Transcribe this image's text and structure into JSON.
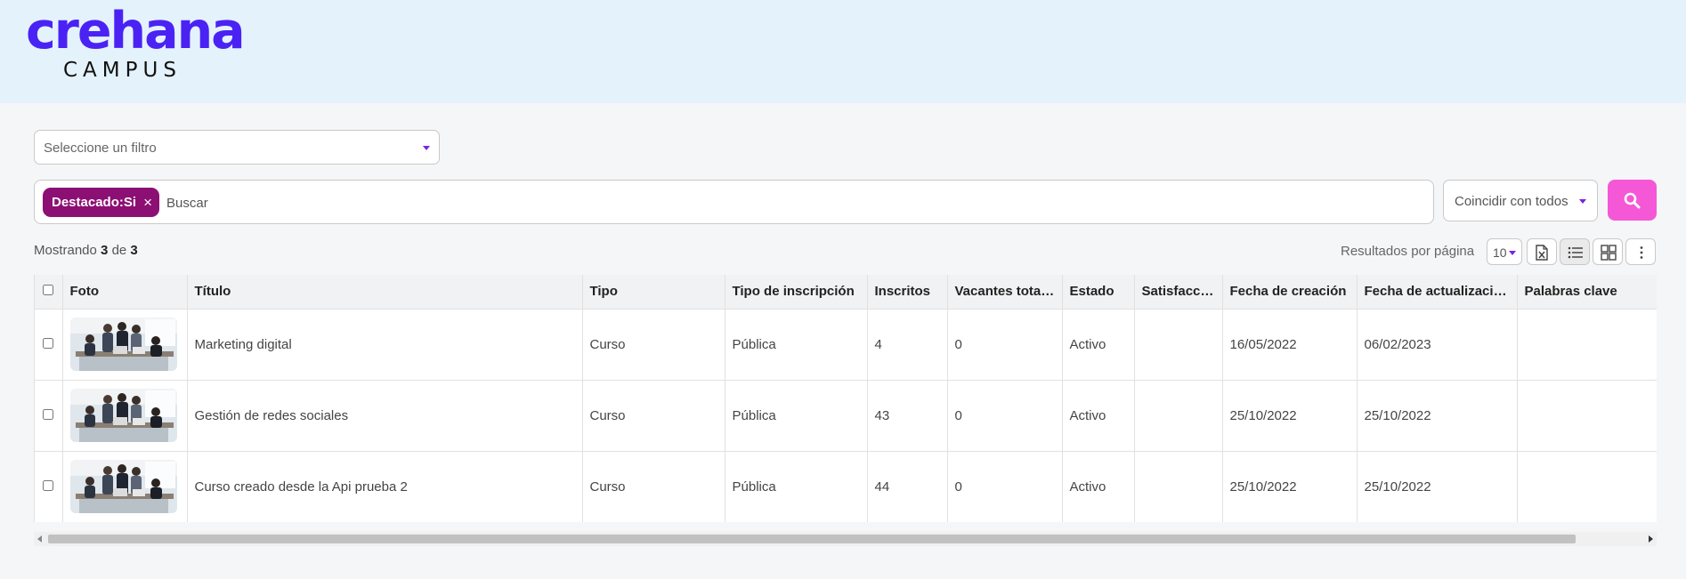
{
  "brand": {
    "name": "crehana",
    "sub": "CAMPUS",
    "color": "#4b22f4"
  },
  "filter": {
    "placeholder": "Seleccione un filtro"
  },
  "search": {
    "chip_label": "Destacado:Si",
    "chip_remove": "×",
    "placeholder": "Buscar",
    "match_mode": "Coincidir con todos",
    "button_icon": "search-icon",
    "button_color": "#f458d6",
    "chip_color": "#8c0f73"
  },
  "results": {
    "prefix": "Mostrando",
    "shown": "3",
    "of": "de",
    "total": "3",
    "per_page_label": "Resultados por página",
    "per_page": "10"
  },
  "toolbar": {
    "icons": [
      "excel-export-icon",
      "list-view-icon",
      "grid-view-icon",
      "more-options-icon"
    ]
  },
  "table": {
    "columns": [
      "Foto",
      "Título",
      "Tipo",
      "Tipo de inscripción",
      "Inscritos",
      "Vacantes total…",
      "Estado",
      "Satisfacci…",
      "Fecha de creación",
      "Fecha de actualización",
      "Palabras clave"
    ],
    "rows": [
      {
        "titulo": "Marketing digital",
        "tipo": "Curso",
        "inscripcion": "Pública",
        "inscritos": "4",
        "vacantes": "0",
        "estado": "Activo",
        "satisfaccion": "",
        "creacion": "16/05/2022",
        "actualizacion": "06/02/2023",
        "palabras": ""
      },
      {
        "titulo": "Gestión de redes sociales",
        "tipo": "Curso",
        "inscripcion": "Pública",
        "inscritos": "43",
        "vacantes": "0",
        "estado": "Activo",
        "satisfaccion": "",
        "creacion": "25/10/2022",
        "actualizacion": "25/10/2022",
        "palabras": ""
      },
      {
        "titulo": "Curso creado desde la Api prueba 2",
        "tipo": "Curso",
        "inscripcion": "Pública",
        "inscritos": "44",
        "vacantes": "0",
        "estado": "Activo",
        "satisfaccion": "",
        "creacion": "25/10/2022",
        "actualizacion": "25/10/2022",
        "palabras": ""
      }
    ]
  }
}
